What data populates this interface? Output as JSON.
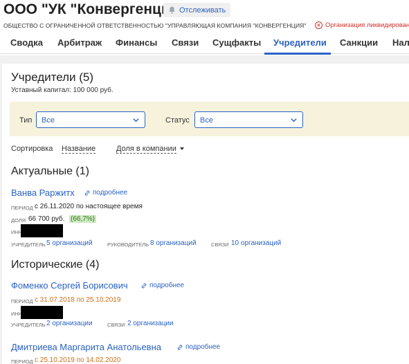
{
  "company": {
    "title": "ООО \"УК \"Конвергенция\"",
    "follow_label": "Отслеживать",
    "full_name": "ОБЩЕСТВО С ОГРАНИЧЕННОЙ ОТВЕТСТВЕННОСТЬЮ \"УПРАВЛЯЮЩАЯ КОМПАНИЯ \"КОНВЕРГЕНЦИЯ\"",
    "status_text": "Организация ликвидирован"
  },
  "tabs": [
    "Сводка",
    "Арбитраж",
    "Финансы",
    "Связи",
    "Сущфакты",
    "Учредители",
    "Санкции",
    "Нало"
  ],
  "active_tab": "Учредители",
  "founders": {
    "heading": "Учредители (5)",
    "capital": "Уставный капитал: 100 000 руб."
  },
  "filters": {
    "type_label": "Тип",
    "type_value": "Все",
    "status_label": "Статус",
    "status_value": "Все"
  },
  "sort": {
    "label": "Сортировка",
    "by_name": "Название",
    "by_share": "Доля в компании"
  },
  "current": {
    "heading": "Актуальные (1)",
    "person": {
      "name": "Ванва Раржитх",
      "more": "подробнее",
      "period_label": "период",
      "period_value": "с 26.11.2020 по настоящее время",
      "share_label": "доля",
      "share_value": "66 700 руб.",
      "share_percent": "(66,7%)",
      "inn_label": "ИНН",
      "founder_label": "учредитель",
      "founder_link": "5 организаций",
      "head_label": "руководитель",
      "head_link": "8 организаций",
      "links_label": "связи",
      "links_link": "10 организаций"
    }
  },
  "historical": {
    "heading": "Исторические (4)",
    "people": [
      {
        "name": "Фоменко Сергей Борисович",
        "more": "подробнее",
        "period_label": "период",
        "from": "с 31.07.2018",
        "to_word": "по",
        "to": "25.10.2019",
        "inn_label": "ИНН",
        "founder_label": "учредитель",
        "founder_link": "2 организации",
        "links_label": "связи",
        "links_link": "2 организации"
      },
      {
        "name": "Дмитриева Маргарита Анатольевна",
        "more": "подробнее",
        "period_label": "период",
        "from": "с 25.10.2019",
        "to_word": "по",
        "to": "14.02.2020"
      }
    ]
  },
  "colors": {
    "accent": "#2a62c3",
    "alert": "#d0302a",
    "history": "#c8701a",
    "filter_bg": "#f6f2dc"
  }
}
